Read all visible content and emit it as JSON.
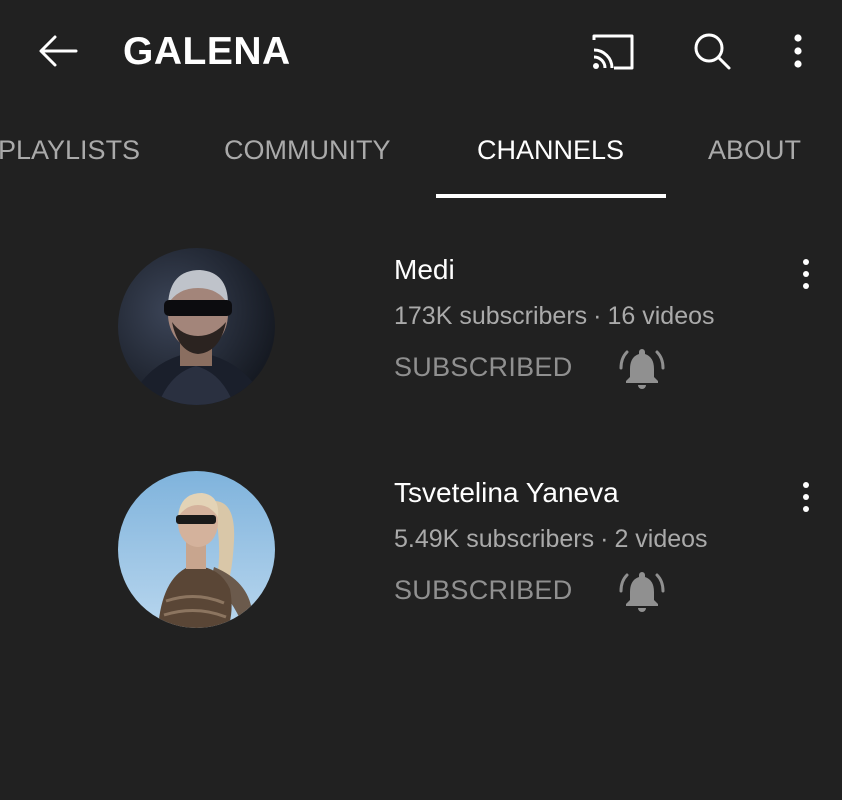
{
  "header": {
    "title": "GALENA",
    "icons": {
      "back": "arrow-back-icon",
      "cast": "cast-icon",
      "search": "search-icon",
      "more": "more-vertical-icon"
    }
  },
  "tabs": [
    {
      "label": "PLAYLISTS",
      "active": false
    },
    {
      "label": "COMMUNITY",
      "active": false
    },
    {
      "label": "CHANNELS",
      "active": true
    },
    {
      "label": "ABOUT",
      "active": false
    }
  ],
  "channels": [
    {
      "name": "Medi",
      "subscribers": "173K subscribers",
      "separator": "·",
      "videos": "16 videos",
      "subscribe_label": "SUBSCRIBED",
      "bell_icon": "notification-bell-icon",
      "more_icon": "more-vertical-icon"
    },
    {
      "name": "Tsvetelina Yaneva",
      "subscribers": "5.49K subscribers",
      "separator": "·",
      "videos": "2 videos",
      "subscribe_label": "SUBSCRIBED",
      "bell_icon": "notification-bell-icon",
      "more_icon": "more-vertical-icon"
    }
  ],
  "colors": {
    "background": "#212121",
    "text_primary": "#ffffff",
    "text_secondary": "#aaaaaa",
    "subscribed": "#909090"
  }
}
